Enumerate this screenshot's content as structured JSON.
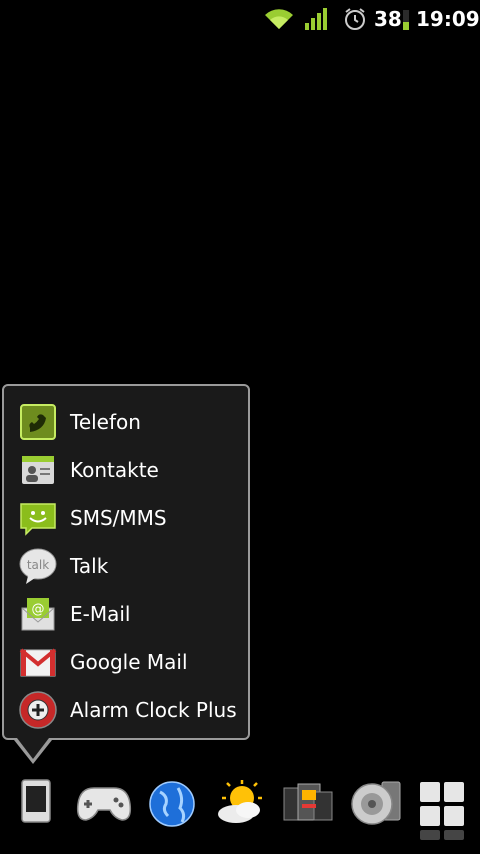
{
  "status_bar": {
    "battery_percent": "38",
    "time": "19:09",
    "icons": [
      "wifi-icon",
      "signal-icon",
      "alarm-icon",
      "battery-icon"
    ]
  },
  "popup_menu": {
    "items": [
      {
        "label": "Telefon",
        "icon": "phone-icon"
      },
      {
        "label": "Kontakte",
        "icon": "contacts-icon"
      },
      {
        "label": "SMS/MMS",
        "icon": "sms-icon"
      },
      {
        "label": "Talk",
        "icon": "talk-icon"
      },
      {
        "label": "E-Mail",
        "icon": "email-icon"
      },
      {
        "label": "Google Mail",
        "icon": "gmail-icon"
      },
      {
        "label": "Alarm Clock Plus",
        "icon": "alarm-clock-plus-icon"
      }
    ]
  },
  "dock": {
    "items": [
      {
        "icon": "phone-handset-icon"
      },
      {
        "icon": "gamepad-icon"
      },
      {
        "icon": "globe-icon"
      },
      {
        "icon": "weather-icon"
      },
      {
        "icon": "files-icon"
      },
      {
        "icon": "speaker-icon"
      },
      {
        "icon": "app-drawer-icon"
      }
    ]
  },
  "colors": {
    "accent_green": "#9acd32",
    "menu_bg": "#1a1a1a",
    "menu_border": "#9a9a9a"
  }
}
